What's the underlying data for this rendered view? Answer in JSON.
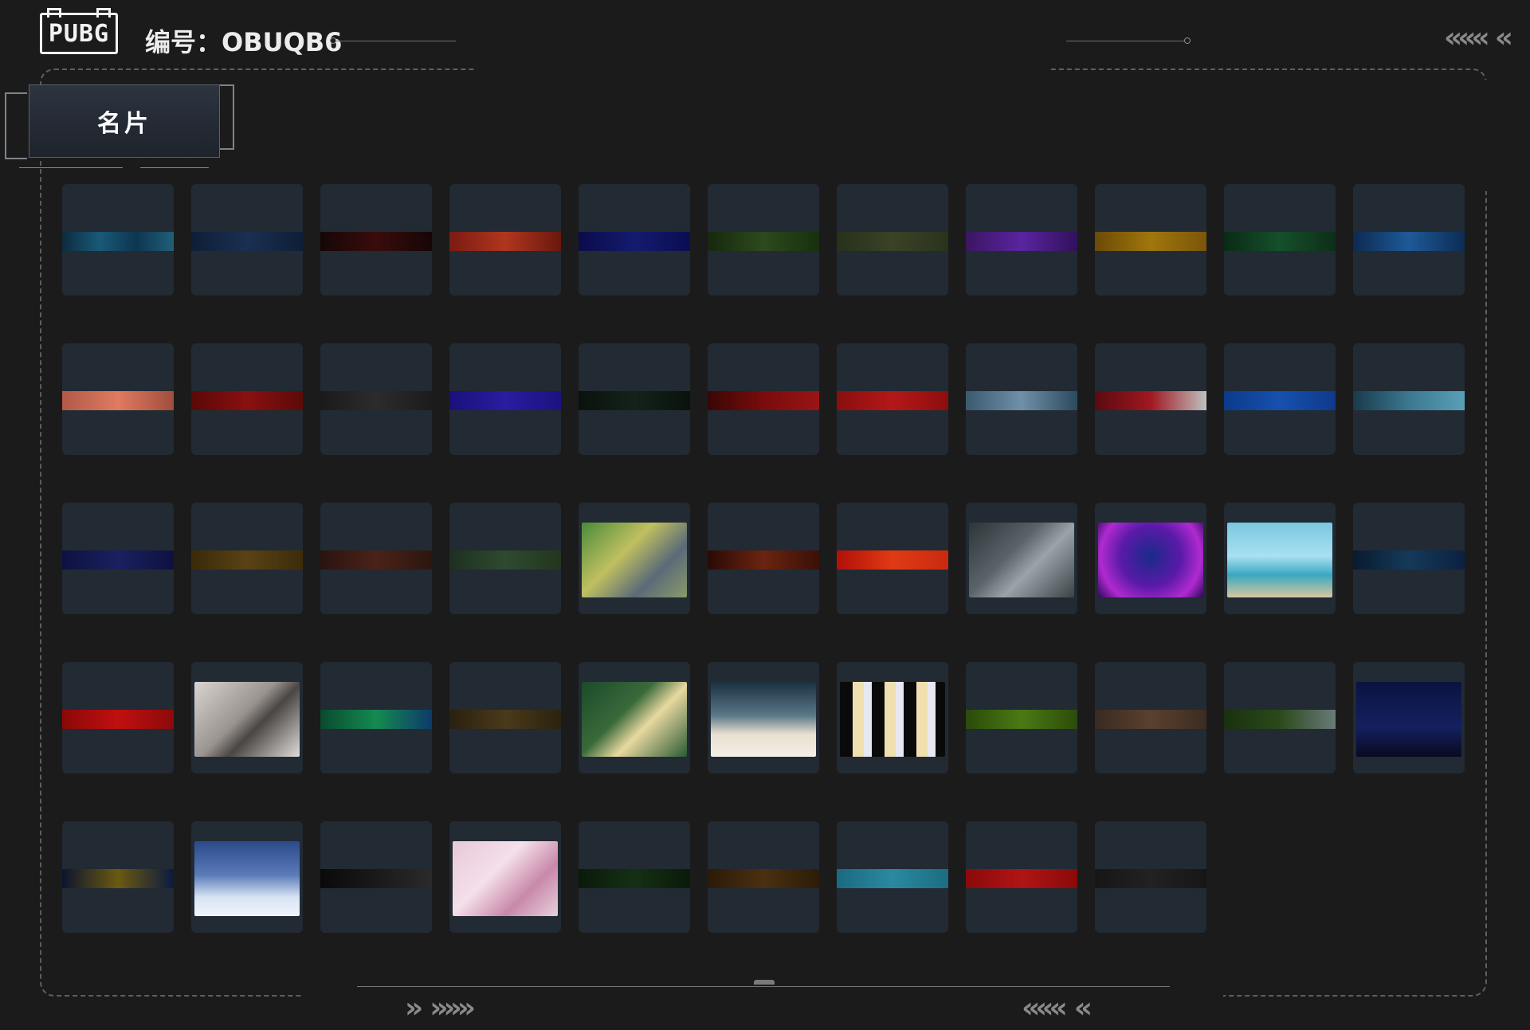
{
  "header": {
    "logo_text": "PUBG",
    "player_code": "编号：OBUQB6"
  },
  "tab": {
    "label": "名片"
  },
  "colors": {
    "background": "#1b1b1b",
    "card": "#222a34",
    "frame_dash": "#5e5e5e"
  },
  "cards": [
    {
      "kind": "strip",
      "style": "linear-gradient(90deg,#0e2a3e,#185a78,#0e3550,#20607a)",
      "icon": "blue-tech"
    },
    {
      "kind": "strip",
      "style": "linear-gradient(90deg,#0e1e36,#1b2f52,#0e1e36)",
      "icon": "moon-phases"
    },
    {
      "kind": "strip",
      "style": "linear-gradient(90deg,#150707,#3a0c0c,#160606)",
      "icon": "dark-red"
    },
    {
      "kind": "strip",
      "style": "linear-gradient(90deg,#7a1b12,#b0361f,#6a170e)",
      "icon": "red-pattern"
    },
    {
      "kind": "strip",
      "style": "linear-gradient(90deg,#0a0c4a,#141a6e,#0a0d52)",
      "icon": "navy"
    },
    {
      "kind": "strip",
      "style": "linear-gradient(90deg,#16280f,#2c4a1c,#17300e)",
      "icon": "green-camo"
    },
    {
      "kind": "strip",
      "style": "linear-gradient(90deg,#27301a,#3a4326,#2a321c)",
      "icon": "olive-text"
    },
    {
      "kind": "strip",
      "style": "linear-gradient(90deg,#3a1660,#5a24a0,#30115a)",
      "icon": "purple"
    },
    {
      "kind": "strip",
      "style": "linear-gradient(90deg,#6a4a08,#a0760c,#7a560a)",
      "icon": "gold"
    },
    {
      "kind": "strip",
      "style": "linear-gradient(90deg,#0a2a16,#15502a,#0c2e18)",
      "icon": "dark-green"
    },
    {
      "kind": "strip",
      "style": "linear-gradient(90deg,#0c2a50,#1e5a98,#0c2c54)",
      "icon": "blue-glow"
    },
    {
      "kind": "strip",
      "style": "linear-gradient(90deg,#b05a48,#e07a60,#a04e3c)",
      "icon": "salmon"
    },
    {
      "kind": "strip",
      "style": "linear-gradient(90deg,#5a0808,#8a1010,#5c0a0a)",
      "icon": "crimson"
    },
    {
      "kind": "strip",
      "style": "linear-gradient(90deg,#1a1a1a,#2c2c2c,#1c1c1c)",
      "icon": "black-texture"
    },
    {
      "kind": "strip",
      "style": "linear-gradient(90deg,#1a107a,#2a1ca0,#1c1280)",
      "icon": "indigo"
    },
    {
      "kind": "strip",
      "style": "linear-gradient(90deg,#0a120e,#14221a,#0a120e)",
      "icon": "dark-camo"
    },
    {
      "kind": "strip",
      "style": "linear-gradient(90deg,#3a0606,#7a0c0c,#9a1414)",
      "icon": "red-black"
    },
    {
      "kind": "strip",
      "style": "linear-gradient(90deg,#8a0e0e,#b41818,#8c0e0e)",
      "icon": "bright-red"
    },
    {
      "kind": "strip",
      "style": "linear-gradient(90deg,#3a5a70,#6e90a8,#2c4a5e)",
      "icon": "mountain"
    },
    {
      "kind": "strip",
      "style": "linear-gradient(90deg,#5a0a10,#a01820,#c0c0c0)",
      "icon": "red-white"
    },
    {
      "kind": "strip",
      "style": "linear-gradient(90deg,#0c3a8a,#1650b0,#0e3a8a)",
      "icon": "royal-blue"
    },
    {
      "kind": "strip",
      "style": "linear-gradient(90deg,#1a3a4a,#3a7890,#5aa0b8)",
      "icon": "teal-lion"
    },
    {
      "kind": "strip",
      "style": "linear-gradient(90deg,#0e1240,#1a2060,#0e1240)",
      "icon": "navy-swirl"
    },
    {
      "kind": "strip",
      "style": "linear-gradient(90deg,#3a2a0a,#5a4214,#3c2c0c)",
      "icon": "bronze"
    },
    {
      "kind": "strip",
      "style": "linear-gradient(90deg,#2a1410,#4a2218,#2c1610)",
      "icon": "maroon"
    },
    {
      "kind": "strip",
      "style": "linear-gradient(90deg,#1e3020,#2e4a30,#22361e)",
      "icon": "green-hand"
    },
    {
      "kind": "pic",
      "style": "linear-gradient(135deg,#4a8a3a,#c0c060 40%,#5a6a78 70%,#8a9a6a)",
      "icon": "frog-knight"
    },
    {
      "kind": "strip",
      "style": "linear-gradient(90deg,#2a0a06,#6a2410,#3a1008)",
      "icon": "rust"
    },
    {
      "kind": "strip",
      "style": "linear-gradient(90deg,#b01008,#e03a14,#c82a10)",
      "icon": "orange-red"
    },
    {
      "kind": "pic",
      "style": "linear-gradient(135deg,#2c3438,#5a6468 40%,#9aa4a8 60%,#3a4246)",
      "icon": "silver-logo"
    },
    {
      "kind": "pic",
      "style": "radial-gradient(circle at 50% 45%,#1a2a8a,#5a1aa8 45%,#b02ad0 75%,#2a0a5a)",
      "icon": "hooded-figure"
    },
    {
      "kind": "pic",
      "style": "linear-gradient(180deg,#7ac8e0,#a8e0f0 45%,#3aa8c0 70%,#d8c8a0)",
      "icon": "seagull"
    },
    {
      "kind": "strip",
      "style": "linear-gradient(90deg,#0a1a30,#143a5a,#0c2040)",
      "icon": "deep-blue"
    },
    {
      "kind": "strip",
      "style": "linear-gradient(90deg,#8a0808,#c01010,#8c0a0a)",
      "icon": "red-splash"
    },
    {
      "kind": "pic",
      "style": "linear-gradient(135deg,#d8d4d0,#9a9490 45%,#4a4644 60%,#e0dcd8)",
      "icon": "bird-snow"
    },
    {
      "kind": "strip",
      "style": "linear-gradient(90deg,#0a4a30,#148a50,#0e3a6a)",
      "icon": "aurora"
    },
    {
      "kind": "strip",
      "style": "linear-gradient(90deg,#2a2010,#4a3a1a,#2c2210)",
      "icon": "brown-swirl"
    },
    {
      "kind": "pic",
      "style": "linear-gradient(135deg,#1a4a2a,#3a6a3a 40%,#e8d8a0 60%,#2a5a34)",
      "icon": "champagne"
    },
    {
      "kind": "pic",
      "style": "linear-gradient(180deg,#1a3040,#5a7888 45%,#e8e0d0 70%,#f4f0e8)",
      "icon": "snowman"
    },
    {
      "kind": "pic",
      "style": "repeating-linear-gradient(90deg,#0a0a0a 0 16px,#f0e0b0 16px 30px,#e8e8f0 30px 40px)",
      "icon": "anime-girls"
    },
    {
      "kind": "strip",
      "style": "linear-gradient(90deg,#2a4a0a,#4a7a14,#2c4c0a)",
      "icon": "lime"
    },
    {
      "kind": "strip",
      "style": "linear-gradient(90deg,#3a2a20,#5a4030,#3c2c20)",
      "icon": "taupe"
    },
    {
      "kind": "strip",
      "style": "linear-gradient(90deg,#1a3010,#2a4a1a,#6a7a7a)",
      "icon": "shark"
    },
    {
      "kind": "pic",
      "style": "linear-gradient(180deg,#0a1440,#142060 60%,#0a0a20)",
      "icon": "night-text"
    },
    {
      "kind": "strip",
      "style": "linear-gradient(90deg,#0c1430,#6a5a10,#0c1a40)",
      "icon": "navy-gold"
    },
    {
      "kind": "pic",
      "style": "linear-gradient(180deg,#2a4a8a,#5a7ab8 45%,#d8e4f4 75%,#f0f4fa)",
      "icon": "winter-village"
    },
    {
      "kind": "strip",
      "style": "linear-gradient(90deg,#0a0a0a,#1a1a1a,#2a2a2a)",
      "icon": "black-scale"
    },
    {
      "kind": "pic",
      "style": "linear-gradient(135deg,#e8c8d8,#f4e0ea 40%,#c888a8 70%,#e8d0dc)",
      "icon": "cute-bunnies"
    },
    {
      "kind": "strip",
      "style": "linear-gradient(90deg,#0a1a0a,#143014,#0a1a0a)",
      "icon": "dark-eye"
    },
    {
      "kind": "strip",
      "style": "linear-gradient(90deg,#2a1a08,#4a3010,#2c1c08)",
      "icon": "dark-amber"
    },
    {
      "kind": "strip",
      "style": "linear-gradient(90deg,#1a6a80,#2a8aa0,#1c6c80)",
      "icon": "turquoise"
    },
    {
      "kind": "strip",
      "style": "linear-gradient(90deg,#8a0a0a,#b01414,#8a0a0a)",
      "icon": "red-zigzag"
    },
    {
      "kind": "strip",
      "style": "linear-gradient(90deg,#161616,#222222,#161616)",
      "icon": "charcoal"
    }
  ]
}
